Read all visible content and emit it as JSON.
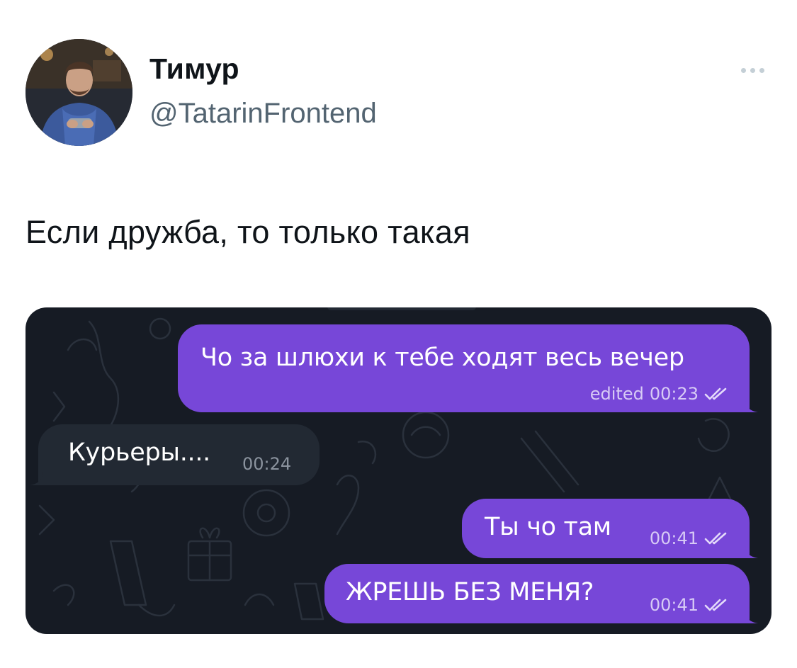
{
  "tweet": {
    "author": {
      "name": "Тимур",
      "handle": "@TatarinFrontend",
      "avatar_icon": "avatar-photo"
    },
    "more_icon": "more-horizontal-icon",
    "text": "Если дружба, то только такая"
  },
  "chat": {
    "colors": {
      "background": "#161b24",
      "outgoing_bubble": "#7747d8",
      "incoming_bubble": "#222933"
    },
    "messages": [
      {
        "direction": "outgoing",
        "text": "Чо за шлюхи к тебе ходят весь вечер",
        "edited_label": "edited",
        "time": "00:23",
        "status_icon": "double-check-icon"
      },
      {
        "direction": "incoming",
        "text": "Курьеры....",
        "time": "00:24"
      },
      {
        "direction": "outgoing",
        "text": "Ты чо там",
        "time": "00:41",
        "status_icon": "double-check-icon"
      },
      {
        "direction": "outgoing",
        "text": "ЖРЕШЬ БЕЗ МЕНЯ?",
        "time": "00:41",
        "status_icon": "double-check-icon"
      }
    ]
  }
}
